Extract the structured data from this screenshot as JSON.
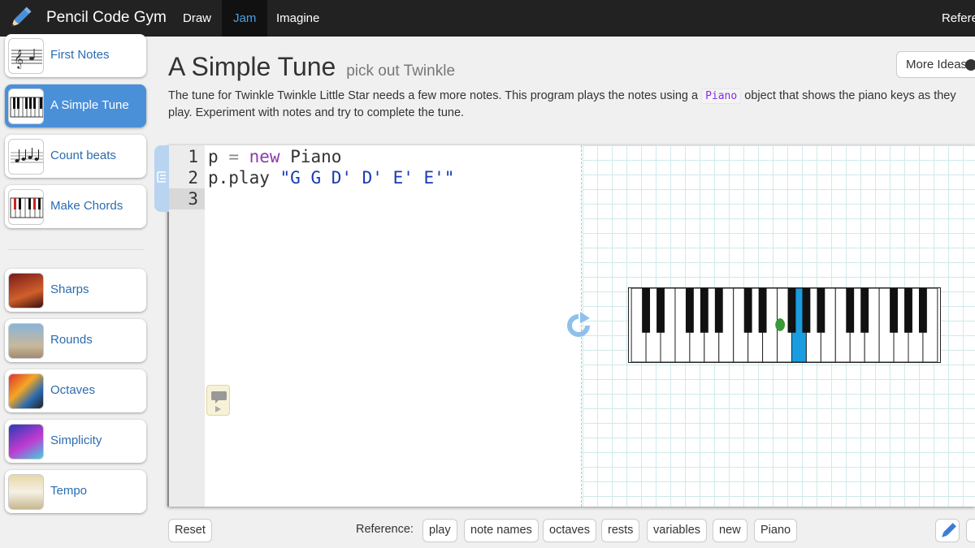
{
  "app": {
    "title": "Pencil Code Gym"
  },
  "nav": {
    "tabs": [
      {
        "label": "Draw",
        "active": false
      },
      {
        "label": "Jam",
        "active": true
      },
      {
        "label": "Imagine",
        "active": false
      }
    ],
    "reference_label": "Refere"
  },
  "sidebar": {
    "items": [
      {
        "label": "First Notes",
        "icon": "treble-clef-staff-icon",
        "active": false
      },
      {
        "label": "A Simple Tune",
        "icon": "piano-keys-icon",
        "active": true
      },
      {
        "label": "Count beats",
        "icon": "music-staff-notes-icon",
        "active": false
      },
      {
        "label": "Make Chords",
        "icon": "colored-piano-keys-icon",
        "active": false
      },
      {
        "label": "Sharps",
        "icon": "sharps-thumbnail-image",
        "active": false
      },
      {
        "label": "Rounds",
        "icon": "rounds-thumbnail-image",
        "active": false
      },
      {
        "label": "Octaves",
        "icon": "octaves-thumbnail-image",
        "active": false
      },
      {
        "label": "Simplicity",
        "icon": "simplicity-thumbnail-image",
        "active": false
      },
      {
        "label": "Tempo",
        "icon": "tempo-thumbnail-image",
        "active": false
      }
    ]
  },
  "main": {
    "title": "A Simple Tune",
    "subtitle": "pick out Twinkle",
    "more_ideas_label": "More Ideas",
    "description_before": "The tune for Twinkle Twinkle Little Star needs a few more notes. This program plays the notes using a",
    "description_code": "Piano",
    "description_after": "object that shows the piano keys as they play. Experiment with notes and try to complete the tune."
  },
  "editor": {
    "line_numbers": [
      "1",
      "2",
      "3"
    ],
    "code_line1_var": "p",
    "code_line1_op": "=",
    "code_line1_kw": "new",
    "code_line1_cls": "Piano",
    "code_line2_call": "p.play",
    "code_line2_str": "\"G G D' D' E' E'\""
  },
  "piano": {
    "highlighted_key_color": "#1a9de0"
  },
  "toolbar": {
    "reset_label": "Reset",
    "reference_label": "Reference:",
    "reference_links": [
      "play",
      "note names",
      "octaves",
      "rests",
      "variables",
      "new",
      "Piano"
    ]
  },
  "colors": {
    "topbar": "#222222",
    "accent": "#4a90d9",
    "active_tab_text": "#4a9fe6"
  }
}
